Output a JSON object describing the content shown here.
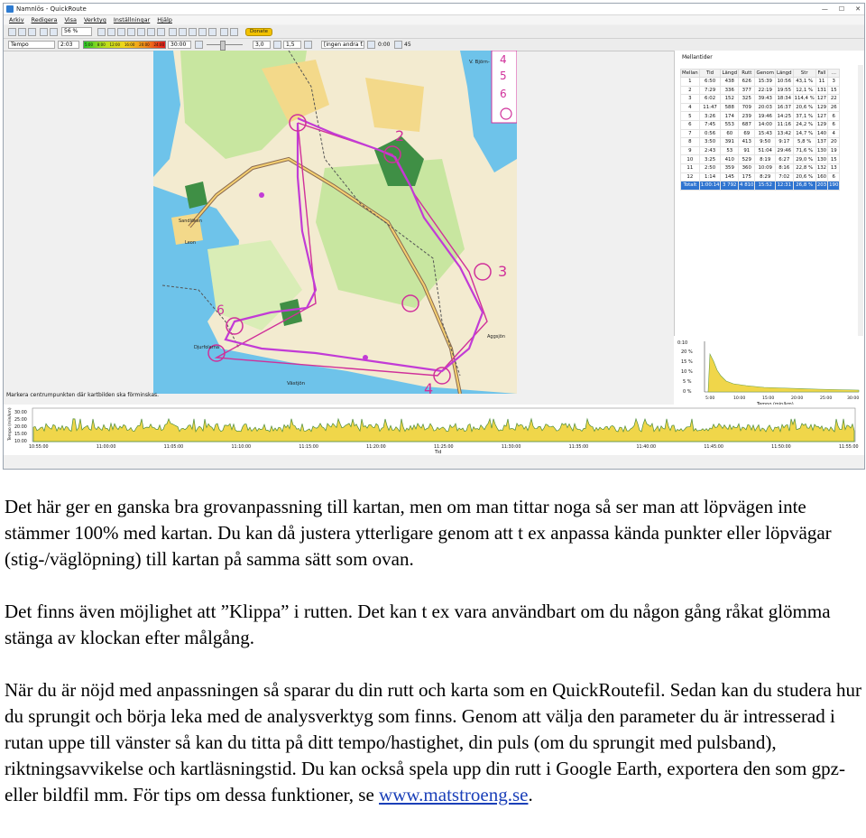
{
  "window": {
    "title": "Namnlös - QuickRoute",
    "minimize_glyph": "—",
    "maximize_glyph": "☐",
    "close_glyph": "✕"
  },
  "menu": [
    "Arkiv",
    "Redigera",
    "Visa",
    "Verktyg",
    "Inställningar",
    "Hjälp"
  ],
  "toolbar": {
    "zoom_value": "56 %",
    "donate_label": "Donate",
    "mode_select": "Tempo",
    "speed_value": "2:03",
    "gradient_ticks": [
      "5:00",
      "8:00",
      "12:00",
      "16:00",
      "20:00",
      "24:00"
    ],
    "time_value": "30:00",
    "smoothing_value": "3,0",
    "width_value": "1,5",
    "lap_select": "[ingen andra f.",
    "elapsed_value": "0:00",
    "count_value": "45"
  },
  "map": {
    "legend": [
      "4",
      "5",
      "6"
    ],
    "place_labels": [
      "V. Björn-\nljön",
      "Sandlöken",
      "Leon",
      "Djurfolarna",
      "Västjön",
      "Aggsjön"
    ],
    "controls": [
      "2",
      "3",
      "6",
      "4"
    ]
  },
  "status": {
    "hint": "Markera centrumpunkten där kartbilden ska förminskas."
  },
  "laps": {
    "title": "Mellantider",
    "columns": [
      "Mellan",
      "Tid",
      "Längd",
      "Rutt",
      "Genom",
      "Längd",
      "Str",
      "Fall"
    ],
    "rows": [
      [
        "1",
        "6:50",
        "438",
        "626",
        "15:39",
        "10:56",
        "43,1 %",
        "11",
        "3"
      ],
      [
        "2",
        "7:29",
        "336",
        "377",
        "22:19",
        "19:55",
        "12,1 %",
        "131",
        "15"
      ],
      [
        "3",
        "6:02",
        "152",
        "325",
        "39:43",
        "18:34",
        "114,4 %",
        "127",
        "22"
      ],
      [
        "4",
        "11:47",
        "588",
        "709",
        "20:03",
        "16:37",
        "20,6 %",
        "129",
        "26"
      ],
      [
        "5",
        "3:26",
        "174",
        "239",
        "19:46",
        "14:25",
        "37,1 %",
        "127",
        "6"
      ],
      [
        "6",
        "7:45",
        "553",
        "687",
        "14:00",
        "11:16",
        "24,2 %",
        "129",
        "6"
      ],
      [
        "7",
        "0:56",
        "60",
        "69",
        "15:43",
        "13:42",
        "14,7 %",
        "140",
        "4"
      ],
      [
        "8",
        "3:50",
        "391",
        "413",
        "9:50",
        "9:17",
        "5,8 %",
        "137",
        "20"
      ],
      [
        "9",
        "2:43",
        "53",
        "91",
        "51:04",
        "29:46",
        "71,6 %",
        "130",
        "19"
      ],
      [
        "10",
        "3:25",
        "410",
        "529",
        "8:19",
        "6:27",
        "29,0 %",
        "130",
        "15"
      ],
      [
        "11",
        "2:50",
        "359",
        "360",
        "10:09",
        "8:16",
        "22,8 %",
        "132",
        "13"
      ],
      [
        "12",
        "1:14",
        "145",
        "175",
        "8:29",
        "7:02",
        "20,6 %",
        "160",
        "6"
      ]
    ],
    "total": [
      "Totalt",
      "1:00:14",
      "3 792",
      "4 810",
      "15:52",
      "12:31",
      "26,8 %",
      "203",
      "190"
    ]
  },
  "distribution": {
    "y_ticks": [
      "0:10",
      "20 %",
      "15 %",
      "10 %",
      "5 %",
      "0 %"
    ],
    "x_ticks": [
      "5:00",
      "10:00",
      "15:00",
      "20:00",
      "25:00",
      "30:00"
    ],
    "x_label": "Tempo (min/km)"
  },
  "graph": {
    "y_axis_label": "Tempo (min/km)",
    "y_ticks": [
      "30:00",
      "25:00",
      "20:00",
      "15:00",
      "10:00"
    ],
    "x_ticks": [
      "10:55:00",
      "11:00:00",
      "11:05:00",
      "11:10:00",
      "11:15:00",
      "11:20:00",
      "11:25:00",
      "11:30:00",
      "11:35:00",
      "11:40:00",
      "11:45:00",
      "11:50:00",
      "11:55:00"
    ],
    "x_label": "Tid"
  },
  "article": {
    "p1": "Det här ger en ganska bra grovanpassning till kartan, men om man tittar noga så ser man att löpvägen inte stämmer 100% med kartan. Du kan då justera ytterligare genom att t ex anpassa kända punkter eller löpvägar (stig-/väglöpning) till kartan på samma sätt som ovan.",
    "p2": "Det finns även möjlighet att ”Klippa” i rutten. Det kan t ex vara användbart om du någon gång råkat glömma stänga av klockan efter målgång.",
    "p3_text": "När du är nöjd med anpassningen så sparar du din rutt och karta som en QuickRoutefil. Sedan kan du studera hur du sprungit och börja leka med de analysverktyg som finns. Genom att välja den parameter du är intresserad i rutan uppe till vänster så kan du titta på ditt tempo/hastighet, din puls (om du sprungit med pulsband), riktningsavvikelse och kartläsningstid. Du kan också spela upp din rutt i Google Earth, exportera den som gpz- eller bildfil mm. För tips om dessa funktioner, se ",
    "p3_link": "www.matstroeng.se",
    "p3_end": "."
  },
  "colors": {
    "water": "#6ec3ea",
    "forest": "#c8e6a0",
    "open": "#f3d98a",
    "route": "#c23bd6",
    "course": "#d0309a",
    "total_row": "#2f74d0",
    "graph_fill": "#f0d64a"
  }
}
